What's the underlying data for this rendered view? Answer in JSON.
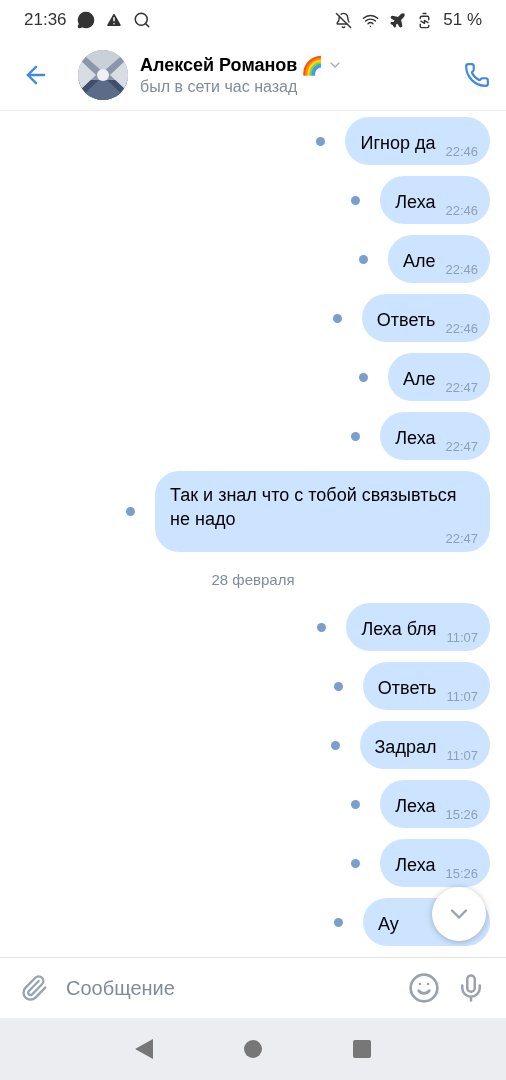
{
  "status_bar": {
    "time": "21:36",
    "battery": "51 %"
  },
  "header": {
    "name": "Алексей Романов",
    "emoji": "🌈",
    "status": "был в сети час назад"
  },
  "messages": [
    {
      "kind": "message",
      "text": "Игнор да",
      "time": "22:46",
      "unread": true
    },
    {
      "kind": "message",
      "text": "Леха",
      "time": "22:46",
      "unread": true
    },
    {
      "kind": "message",
      "text": "Але",
      "time": "22:46",
      "unread": true
    },
    {
      "kind": "message",
      "text": "Ответь",
      "time": "22:46",
      "unread": true
    },
    {
      "kind": "message",
      "text": "Але",
      "time": "22:47",
      "unread": true
    },
    {
      "kind": "message",
      "text": "Леха",
      "time": "22:47",
      "unread": true
    },
    {
      "kind": "message",
      "text": "Так и знал что с тобой связывться не надо",
      "time": "22:47",
      "unread": true
    },
    {
      "kind": "date",
      "text": "28 февраля"
    },
    {
      "kind": "message",
      "text": "Леха бля",
      "time": "11:07",
      "unread": true
    },
    {
      "kind": "message",
      "text": "Ответь",
      "time": "11:07",
      "unread": true
    },
    {
      "kind": "message",
      "text": "Задрал",
      "time": "11:07",
      "unread": true
    },
    {
      "kind": "message",
      "text": "Леха",
      "time": "15:26",
      "unread": true
    },
    {
      "kind": "message",
      "text": "Леха",
      "time": "15:26",
      "unread": true
    },
    {
      "kind": "message",
      "text": "Ау",
      "unread": true
    }
  ],
  "composer": {
    "placeholder": "Сообщение"
  }
}
